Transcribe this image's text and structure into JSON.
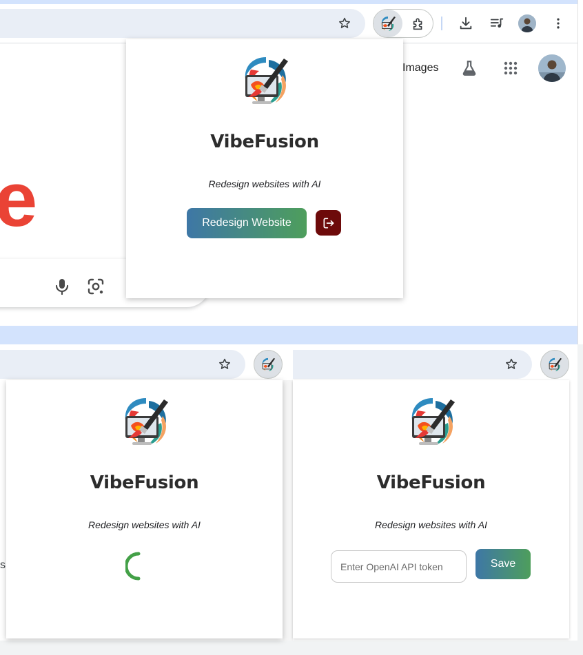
{
  "browser": {
    "accent": "#d3e3fd",
    "omnibox_bg": "#e9eef6",
    "google_letter": "e",
    "google_letter_color": "#ea4335",
    "images_link": "Images",
    "toolbar_icons": [
      "star-icon",
      "extension-vibefusion-icon",
      "puzzle-icon",
      "download-icon",
      "media-queue-icon",
      "avatar",
      "more-vert-icon"
    ],
    "app_icons": [
      "flask-icon",
      "apps-grid-icon",
      "avatar"
    ],
    "search_icons": [
      "mic-icon",
      "lens-icon"
    ],
    "truncated_text": "s"
  },
  "popup": {
    "title": "VibeFusion",
    "tagline": "Redesign websites with AI",
    "redesign_button": "Redesign Website",
    "logout_icon": "logout-icon",
    "button_gradient": [
      "#3e77a6",
      "#4e9e5c"
    ],
    "logout_color": "#6d0a0a",
    "spinner_color": "#43a047"
  },
  "token_form": {
    "placeholder": "Enter OpenAI API token",
    "value": "",
    "save_button": "Save"
  }
}
